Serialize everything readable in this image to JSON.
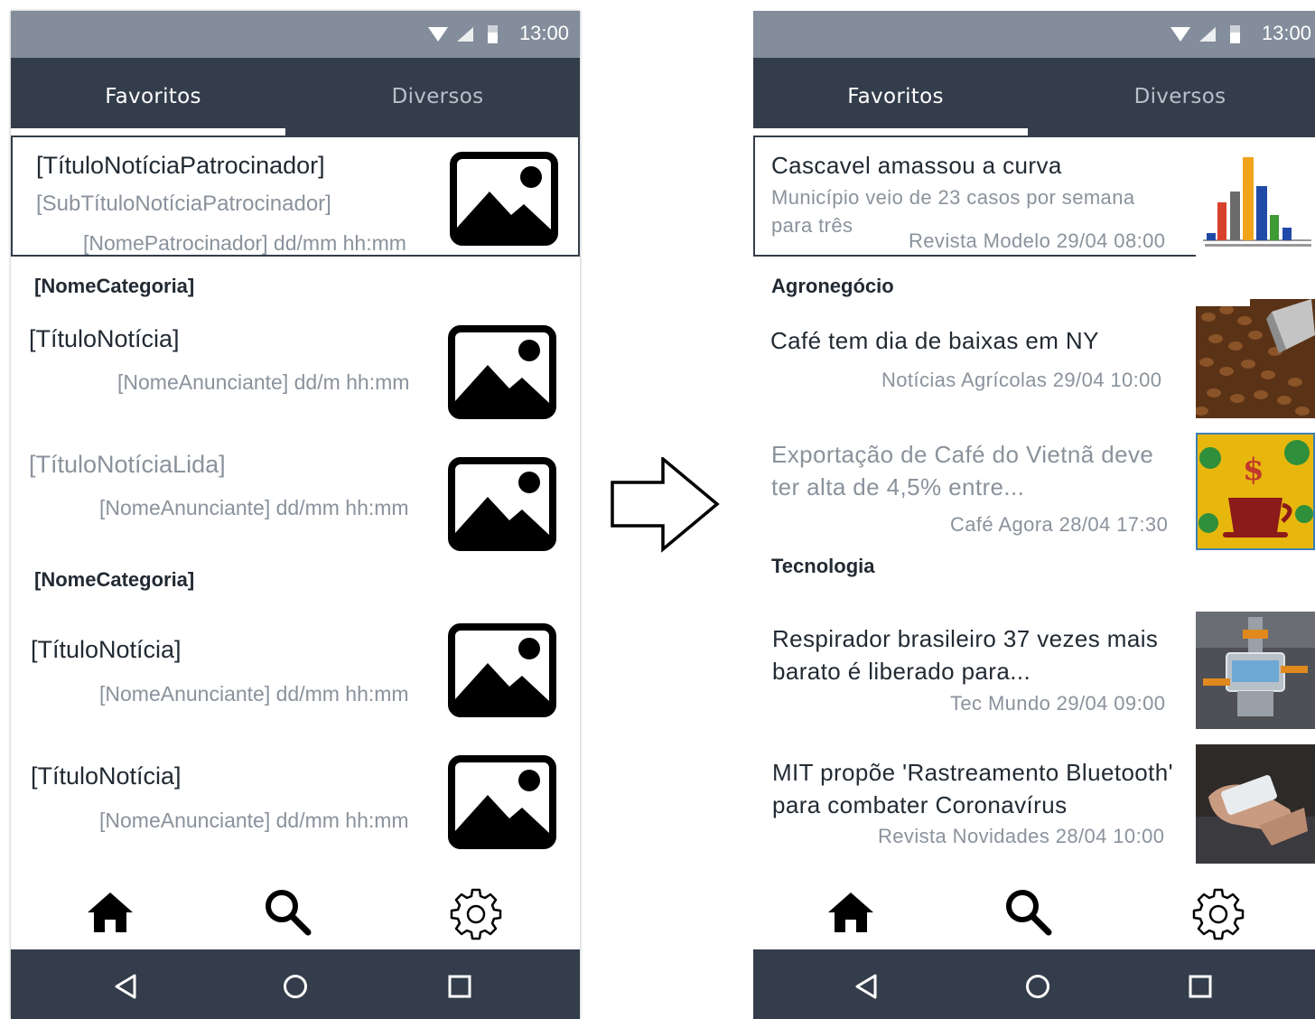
{
  "status_bar": {
    "time": "13:00"
  },
  "tabs": [
    {
      "label": "Favoritos",
      "active": true
    },
    {
      "label": "Diversos",
      "active": false
    }
  ],
  "template_screen": {
    "sponsor": {
      "title": "[TítuloNotíciaPatrocinador]",
      "subtitle": "[SubTítuloNotíciaPatrocinador]",
      "meta": "[NomePatrocinador] dd/mm hh:mm"
    },
    "categories": [
      {
        "name": "[NomeCategoria]",
        "items": [
          {
            "title": "[TítuloNotícia]",
            "meta": "[NomeAnunciante] dd/m hh:mm",
            "read": false
          },
          {
            "title": "[TítuloNotíciaLida]",
            "meta": "[NomeAnunciante] dd/mm hh:mm",
            "read": true
          }
        ]
      },
      {
        "name": "[NomeCategoria]",
        "items": [
          {
            "title": "[TítuloNotícia]",
            "meta": "[NomeAnunciante] dd/mm hh:mm",
            "read": false
          },
          {
            "title": "[TítuloNotícia]",
            "meta": "[NomeAnunciante] dd/mm hh:mm",
            "read": false
          }
        ]
      }
    ]
  },
  "example_screen": {
    "sponsor": {
      "title": "Cascavel amassou a curva",
      "subtitle_line1": "Município veio de 23 casos por semana",
      "subtitle_line2": "para três",
      "meta": "Revista Modelo 29/04 08:00",
      "thumb": "bar-chart-thumbnail"
    },
    "categories": [
      {
        "name": "Agronegócio",
        "items": [
          {
            "title_line1": "Café tem dia de baixas em NY",
            "title_line2": "",
            "meta": "Notícias Agrícolas 29/04 10:00",
            "read": false,
            "thumb": "coffee-beans-thumbnail"
          },
          {
            "title_line1": "Exportação de Café do Vietnã deve",
            "title_line2": "ter alta de 4,5% entre...",
            "meta": "Café Agora 28/04 17:30",
            "read": true,
            "thumb": "coffee-cup-money-thumbnail"
          }
        ]
      },
      {
        "name": "Tecnologia",
        "items": [
          {
            "title_line1": "Respirador brasileiro 37 vezes mais",
            "title_line2": "barato é liberado para...",
            "meta": "Tec Mundo 29/04 09:00",
            "read": false,
            "thumb": "respirator-device-thumbnail"
          },
          {
            "title_line1": "MIT propõe 'Rastreamento Bluetooth'",
            "title_line2": "para combater Coronavírus",
            "meta": "Revista Novidades 28/04 10:00",
            "read": false,
            "thumb": "smartphone-hand-thumbnail"
          }
        ]
      }
    ]
  },
  "bottom_nav": [
    {
      "icon": "home-icon"
    },
    {
      "icon": "search-icon"
    },
    {
      "icon": "settings-gear-icon"
    }
  ],
  "system_nav": [
    {
      "icon": "back-triangle-icon"
    },
    {
      "icon": "home-circle-icon"
    },
    {
      "icon": "recents-square-icon"
    }
  ],
  "colors": {
    "status_bar": "#838d9b",
    "tab_bar": "#343d4b",
    "text_dark": "#222a33",
    "text_muted": "#8a929c"
  }
}
